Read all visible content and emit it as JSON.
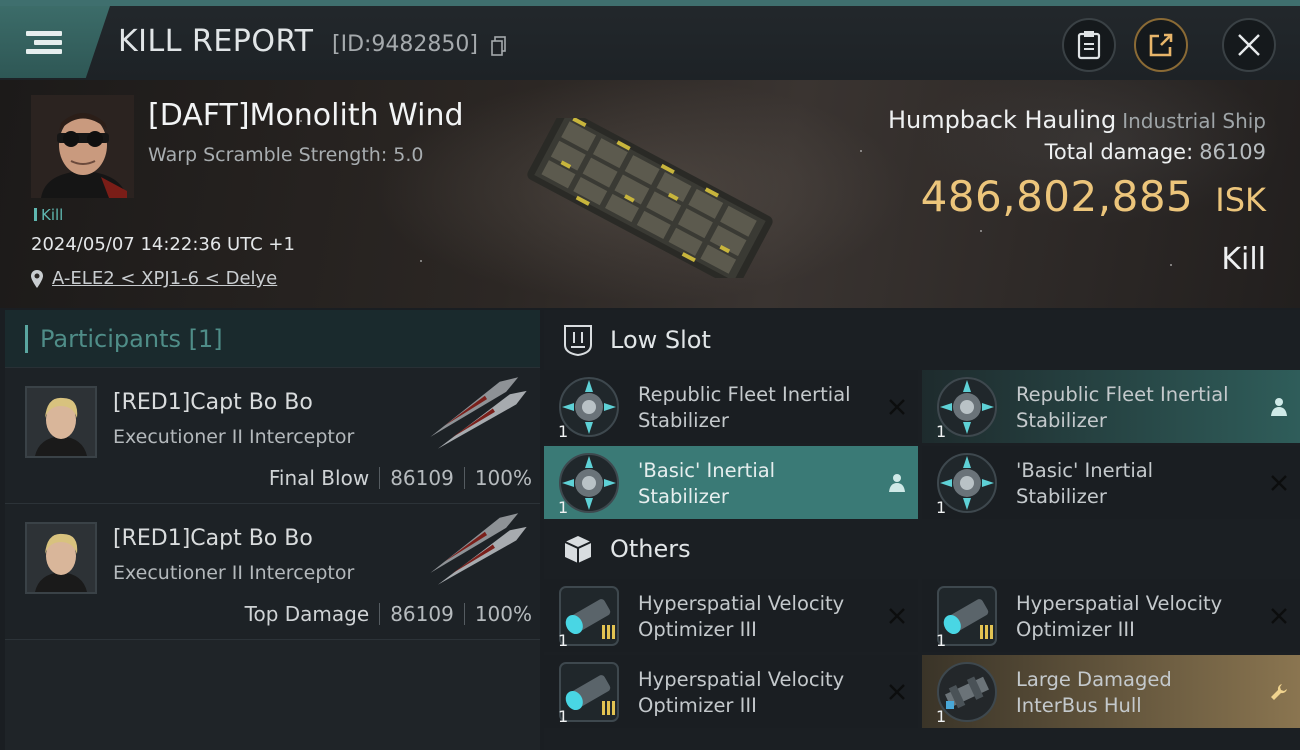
{
  "header": {
    "title": "KILL REPORT",
    "report_id": "[ID:9482850]",
    "icons": [
      "menu-icon",
      "copy-icon",
      "clipboard-icon",
      "share-icon",
      "close-icon"
    ]
  },
  "victim": {
    "pilot_name": "[DAFT]Monolith Wind",
    "warp_scramble": "Warp Scramble Strength: 5.0",
    "tag": "Kill",
    "datetime": "2024/05/07 14:22:36 UTC +1",
    "location": "A-ELE2 < XPJ1-6 < Delye",
    "ship_name": "Humpback Hauling",
    "ship_class": "Industrial Ship",
    "total_damage_label": "Total damage:",
    "total_damage": "86109",
    "isk_value": "486,802,885",
    "isk_unit": "ISK",
    "result": "Kill"
  },
  "participants": {
    "header": "Participants [1]",
    "items": [
      {
        "name": "[RED1]Capt Bo Bo",
        "ship": "Executioner II Interceptor",
        "label": "Final Blow",
        "damage": "86109",
        "percent": "100%"
      },
      {
        "name": "[RED1]Capt Bo Bo",
        "ship": "Executioner II Interceptor",
        "label": "Top Damage",
        "damage": "86109",
        "percent": "100%"
      }
    ]
  },
  "low_slot": {
    "title": "Low Slot",
    "items": [
      {
        "name": "Republic Fleet Inertial Stabilizer",
        "qty": "1",
        "state": "destroyed"
      },
      {
        "name": "Republic Fleet Inertial Stabilizer",
        "qty": "1",
        "state": "dropped"
      },
      {
        "name": "'Basic' Inertial Stabilizer",
        "qty": "1",
        "state": "dropped"
      },
      {
        "name": "'Basic' Inertial Stabilizer",
        "qty": "1",
        "state": "destroyed"
      }
    ]
  },
  "others": {
    "title": "Others",
    "items": [
      {
        "name": "Hyperspatial Velocity Optimizer III",
        "qty": "1",
        "state": "destroyed"
      },
      {
        "name": "Hyperspatial Velocity Optimizer III",
        "qty": "1",
        "state": "destroyed"
      },
      {
        "name": "Hyperspatial Velocity Optimizer III",
        "qty": "1",
        "state": "destroyed"
      },
      {
        "name": "Large Damaged InterBus Hull",
        "qty": "1",
        "state": "salvage"
      }
    ]
  },
  "colors": {
    "accent": "#3a7a76",
    "isk": "#ecc57b",
    "salvage": "#8a7550"
  }
}
